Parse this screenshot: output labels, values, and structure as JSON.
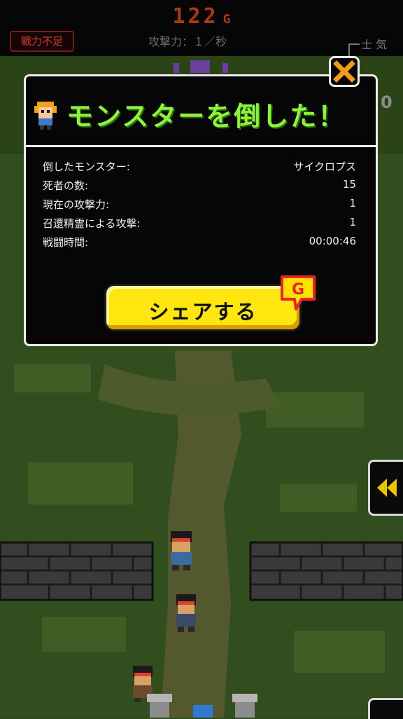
{
  "hud": {
    "gold_value": "122",
    "gold_unit": "G",
    "shortage_label": "戦力不足",
    "attack_rate": "攻撃力：１／秒",
    "morale_label": "士 気",
    "morale_value": "0"
  },
  "dialog": {
    "title": "モンスターを倒した！",
    "stats": [
      {
        "label": "倒したモンスター:",
        "value": "サイクロプス"
      },
      {
        "label": "死者の数:",
        "value": "15"
      },
      {
        "label": "現在の攻撃力:",
        "value": "1"
      },
      {
        "label": "召還精霊による攻撃:",
        "value": "1"
      },
      {
        "label": "戦闘時間:",
        "value": "00:00:46"
      }
    ],
    "share_label": "シェアする",
    "badge_letter": "G"
  },
  "colors": {
    "title_green": "#8ef23e",
    "share_yellow": "#ffe60f",
    "close_orange": "#f39a1c",
    "badge_yellow": "#ffe000",
    "badge_red": "#e8242c"
  }
}
